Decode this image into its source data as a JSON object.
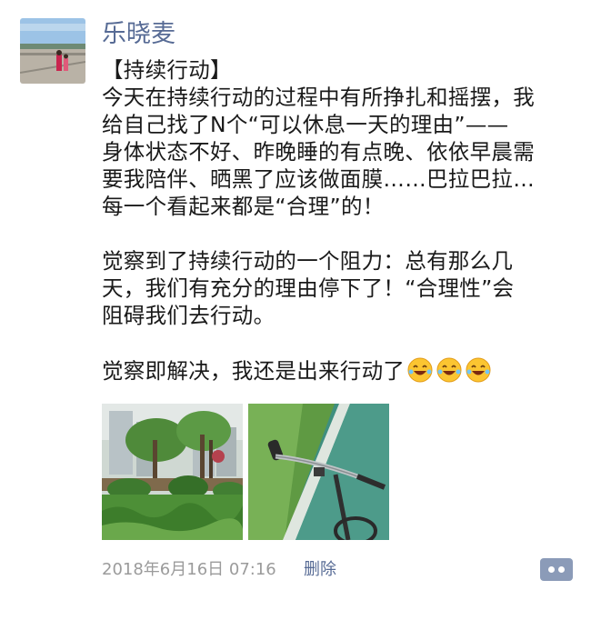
{
  "user": {
    "name": "乐晓麦"
  },
  "post": {
    "lines": [
      "【持续行动】",
      "今天在持续行动的过程中有所挣扎和摇摆，我",
      "给自己找了N个“可以休息一天的理由”——",
      "身体状态不好、昨晚睡的有点晚、依依早晨需",
      "要我陪伴、晒黑了应该做面膜……巴拉巴拉…",
      "每一个看起来都是“合理”的！",
      "",
      "觉察到了持续行动的一个阻力：总有那么几",
      "天，我们有充分的理由停下了！“合理性”会",
      "阻碍我们去行动。",
      "",
      "觉察即解决，我还是出来行动了"
    ],
    "emoji_count": 3,
    "emoji_icon": "laughing-emoji"
  },
  "photos": [
    {
      "icon": "park-greenery-photo"
    },
    {
      "icon": "bicycle-handlebar-photo"
    }
  ],
  "meta": {
    "timestamp": "2018年6月16日 07:16",
    "delete_label": "删除",
    "comment_icon": "comment-more-icon"
  },
  "colors": {
    "link": "#576b95",
    "meta": "#9b9b9b",
    "comment_button": "#8b9bb8"
  }
}
